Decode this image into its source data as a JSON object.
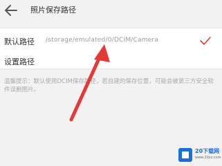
{
  "header": {
    "title": "照片保存路径",
    "back_icon": "back-arrow-icon"
  },
  "settings": {
    "default_label": "默认路径",
    "default_path": "/storage/emulated/0/DCIM/Camera",
    "set_label": "设置路径",
    "check_icon": "checkmark-icon",
    "check_color": "#e53935"
  },
  "hint": "温馨提示：默认使用DCIM保存路径，若自建的保存位置，可能会被第三方安全软件误删图片。",
  "annotation": {
    "arrow_color": "#e53935"
  },
  "watermark": {
    "name": "20下载网",
    "domain": "www.20xz.com",
    "color": "#1b6fd6"
  }
}
